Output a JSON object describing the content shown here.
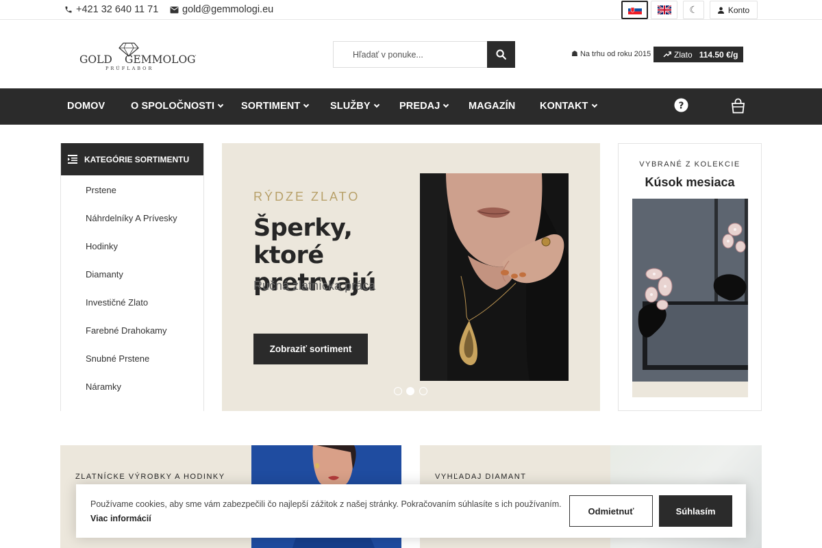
{
  "topbar": {
    "phone": "+421 32 640 11 71",
    "email": "gold@gemmologi.eu",
    "account_label": "Konto",
    "languages": [
      "sk",
      "en"
    ],
    "theme_icon": "moon-icon"
  },
  "header": {
    "logo_text_left": "GOLD",
    "logo_text_right": "GEMMOLOGY",
    "logo_tagline": "PRÚFLABOR",
    "search_placeholder": "Hľadať v ponuke...",
    "since_text": "Na trhu od roku 2015",
    "gold_label": "Zlato",
    "gold_price": "114.50 €/g"
  },
  "nav": {
    "items": [
      {
        "label": "DOMOV"
      },
      {
        "label": "O SPOLOČNOSTI"
      },
      {
        "label": "SORTIMENT"
      },
      {
        "label": "SLUŽBY"
      },
      {
        "label": "PREDAJ"
      },
      {
        "label": "MAGAZÍN"
      },
      {
        "label": "KONTAKT"
      }
    ]
  },
  "sidebar": {
    "title": "KATEGÓRIE SORTIMENTU",
    "categories": [
      "Prstene",
      "Náhrdelníky A Prívesky",
      "Hodinky",
      "Diamanty",
      "Investičné Zlato",
      "Farebné Drahokamy",
      "Snubné Prstene",
      "Náramky"
    ]
  },
  "hero": {
    "kicker": "RÝDZE ZLATO",
    "title": "Šperky, ktoré pretrvajú",
    "subtitle": "Ručná zlatnícka práca",
    "cta": "Zobraziť sortiment",
    "slides_total": 3,
    "slide_active": 2
  },
  "collection": {
    "kicker": "VYBRANÉ Z KOLEKCIE",
    "title": "Kúsok mesiaca"
  },
  "promos": [
    {
      "kicker": "ZLATNÍCKE VÝROBKY A HODINKY"
    },
    {
      "kicker": "VYHĽADAJ DIAMANT"
    }
  ],
  "cookie": {
    "text": "Používame cookies, aby sme vám zabezpečili čo najlepší zážitok z našej stránky. Pokračovaním súhlasíte s ich používaním.",
    "more_link": "Viac informácií",
    "reject": "Odmietnuť",
    "accept": "Súhlasím"
  },
  "colors": {
    "dark": "#2b2b2b",
    "beige": "#ece7dc",
    "gold_accent": "#b8a16a"
  }
}
